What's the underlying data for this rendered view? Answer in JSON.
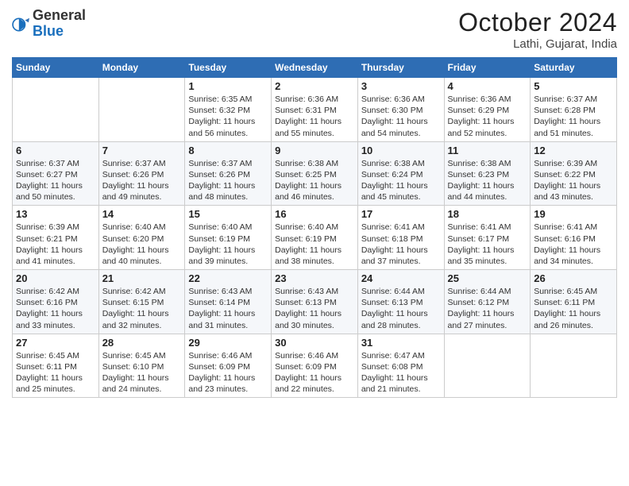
{
  "header": {
    "logo_general": "General",
    "logo_blue": "Blue",
    "month_title": "October 2024",
    "location": "Lathi, Gujarat, India"
  },
  "calendar": {
    "days_of_week": [
      "Sunday",
      "Monday",
      "Tuesday",
      "Wednesday",
      "Thursday",
      "Friday",
      "Saturday"
    ],
    "weeks": [
      [
        {
          "day": "",
          "info": ""
        },
        {
          "day": "",
          "info": ""
        },
        {
          "day": "1",
          "info": "Sunrise: 6:35 AM\nSunset: 6:32 PM\nDaylight: 11 hours and 56 minutes."
        },
        {
          "day": "2",
          "info": "Sunrise: 6:36 AM\nSunset: 6:31 PM\nDaylight: 11 hours and 55 minutes."
        },
        {
          "day": "3",
          "info": "Sunrise: 6:36 AM\nSunset: 6:30 PM\nDaylight: 11 hours and 54 minutes."
        },
        {
          "day": "4",
          "info": "Sunrise: 6:36 AM\nSunset: 6:29 PM\nDaylight: 11 hours and 52 minutes."
        },
        {
          "day": "5",
          "info": "Sunrise: 6:37 AM\nSunset: 6:28 PM\nDaylight: 11 hours and 51 minutes."
        }
      ],
      [
        {
          "day": "6",
          "info": "Sunrise: 6:37 AM\nSunset: 6:27 PM\nDaylight: 11 hours and 50 minutes."
        },
        {
          "day": "7",
          "info": "Sunrise: 6:37 AM\nSunset: 6:26 PM\nDaylight: 11 hours and 49 minutes."
        },
        {
          "day": "8",
          "info": "Sunrise: 6:37 AM\nSunset: 6:26 PM\nDaylight: 11 hours and 48 minutes."
        },
        {
          "day": "9",
          "info": "Sunrise: 6:38 AM\nSunset: 6:25 PM\nDaylight: 11 hours and 46 minutes."
        },
        {
          "day": "10",
          "info": "Sunrise: 6:38 AM\nSunset: 6:24 PM\nDaylight: 11 hours and 45 minutes."
        },
        {
          "day": "11",
          "info": "Sunrise: 6:38 AM\nSunset: 6:23 PM\nDaylight: 11 hours and 44 minutes."
        },
        {
          "day": "12",
          "info": "Sunrise: 6:39 AM\nSunset: 6:22 PM\nDaylight: 11 hours and 43 minutes."
        }
      ],
      [
        {
          "day": "13",
          "info": "Sunrise: 6:39 AM\nSunset: 6:21 PM\nDaylight: 11 hours and 41 minutes."
        },
        {
          "day": "14",
          "info": "Sunrise: 6:40 AM\nSunset: 6:20 PM\nDaylight: 11 hours and 40 minutes."
        },
        {
          "day": "15",
          "info": "Sunrise: 6:40 AM\nSunset: 6:19 PM\nDaylight: 11 hours and 39 minutes."
        },
        {
          "day": "16",
          "info": "Sunrise: 6:40 AM\nSunset: 6:19 PM\nDaylight: 11 hours and 38 minutes."
        },
        {
          "day": "17",
          "info": "Sunrise: 6:41 AM\nSunset: 6:18 PM\nDaylight: 11 hours and 37 minutes."
        },
        {
          "day": "18",
          "info": "Sunrise: 6:41 AM\nSunset: 6:17 PM\nDaylight: 11 hours and 35 minutes."
        },
        {
          "day": "19",
          "info": "Sunrise: 6:41 AM\nSunset: 6:16 PM\nDaylight: 11 hours and 34 minutes."
        }
      ],
      [
        {
          "day": "20",
          "info": "Sunrise: 6:42 AM\nSunset: 6:16 PM\nDaylight: 11 hours and 33 minutes."
        },
        {
          "day": "21",
          "info": "Sunrise: 6:42 AM\nSunset: 6:15 PM\nDaylight: 11 hours and 32 minutes."
        },
        {
          "day": "22",
          "info": "Sunrise: 6:43 AM\nSunset: 6:14 PM\nDaylight: 11 hours and 31 minutes."
        },
        {
          "day": "23",
          "info": "Sunrise: 6:43 AM\nSunset: 6:13 PM\nDaylight: 11 hours and 30 minutes."
        },
        {
          "day": "24",
          "info": "Sunrise: 6:44 AM\nSunset: 6:13 PM\nDaylight: 11 hours and 28 minutes."
        },
        {
          "day": "25",
          "info": "Sunrise: 6:44 AM\nSunset: 6:12 PM\nDaylight: 11 hours and 27 minutes."
        },
        {
          "day": "26",
          "info": "Sunrise: 6:45 AM\nSunset: 6:11 PM\nDaylight: 11 hours and 26 minutes."
        }
      ],
      [
        {
          "day": "27",
          "info": "Sunrise: 6:45 AM\nSunset: 6:11 PM\nDaylight: 11 hours and 25 minutes."
        },
        {
          "day": "28",
          "info": "Sunrise: 6:45 AM\nSunset: 6:10 PM\nDaylight: 11 hours and 24 minutes."
        },
        {
          "day": "29",
          "info": "Sunrise: 6:46 AM\nSunset: 6:09 PM\nDaylight: 11 hours and 23 minutes."
        },
        {
          "day": "30",
          "info": "Sunrise: 6:46 AM\nSunset: 6:09 PM\nDaylight: 11 hours and 22 minutes."
        },
        {
          "day": "31",
          "info": "Sunrise: 6:47 AM\nSunset: 6:08 PM\nDaylight: 11 hours and 21 minutes."
        },
        {
          "day": "",
          "info": ""
        },
        {
          "day": "",
          "info": ""
        }
      ]
    ]
  }
}
